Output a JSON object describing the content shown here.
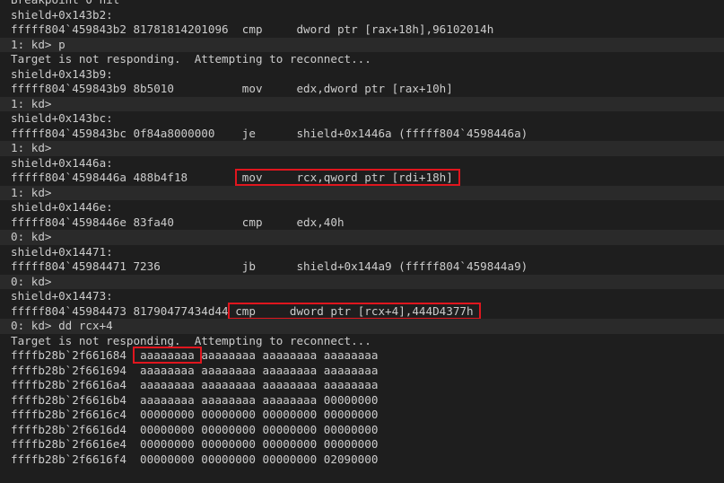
{
  "window": {
    "lines": [
      {
        "text": "Breakpoint 0 hit",
        "kind": "output"
      },
      {
        "text": "shield+0x143b2:",
        "kind": "output"
      },
      {
        "prefix": "fffff804`459843b2 81781814201096  ",
        "instr": "cmp     dword ptr [rax+18h],96102014h",
        "kind": "output"
      },
      {
        "text": "1: kd> p",
        "kind": "command"
      },
      {
        "text": "Target is not responding.  Attempting to reconnect...",
        "kind": "output"
      },
      {
        "text": "shield+0x143b9:",
        "kind": "output"
      },
      {
        "prefix": "fffff804`459843b9 8b5010          ",
        "instr": "mov     edx,dword ptr [rax+10h]",
        "kind": "output"
      },
      {
        "text": "1: kd>",
        "kind": "command"
      },
      {
        "text": "shield+0x143bc:",
        "kind": "output"
      },
      {
        "prefix": "fffff804`459843bc 0f84a8000000    ",
        "instr": "je      shield+0x1446a (fffff804`4598446a)",
        "kind": "output"
      },
      {
        "text": "1: kd>",
        "kind": "command"
      },
      {
        "text": "shield+0x1446a:",
        "kind": "output"
      },
      {
        "prefix": "fffff804`4598446a 488b4f18        ",
        "instr": "mov     rcx,qword ptr [rdi+18h]",
        "kind": "output",
        "highlight": true
      },
      {
        "text": "1: kd>",
        "kind": "command"
      },
      {
        "text": "shield+0x1446e:",
        "kind": "output"
      },
      {
        "prefix": "fffff804`4598446e 83fa40          ",
        "instr": "cmp     edx,40h",
        "kind": "output"
      },
      {
        "text": "0: kd>",
        "kind": "command"
      },
      {
        "text": "shield+0x14471:",
        "kind": "output"
      },
      {
        "prefix": "fffff804`45984471 7236            ",
        "instr": "jb      shield+0x144a9 (fffff804`459844a9)",
        "kind": "output"
      },
      {
        "text": "0: kd>",
        "kind": "command"
      },
      {
        "text": "shield+0x14473:",
        "kind": "output"
      },
      {
        "prefix": "fffff804`45984473 81790477434d44 ",
        "instr": "cmp     dword ptr [rcx+4],444D4377h",
        "kind": "output",
        "highlight": true
      },
      {
        "text": "0: kd> dd rcx+4",
        "kind": "command"
      },
      {
        "text": "Target is not responding.  Attempting to reconnect...",
        "kind": "output"
      },
      {
        "prefix": "ffffb28b`2f661684  ",
        "instr": "aaaaaaaa",
        "suffix": " aaaaaaaa aaaaaaaa aaaaaaaa",
        "kind": "output",
        "highlight": true
      },
      {
        "text": "ffffb28b`2f661694  aaaaaaaa aaaaaaaa aaaaaaaa aaaaaaaa",
        "kind": "output"
      },
      {
        "text": "ffffb28b`2f6616a4  aaaaaaaa aaaaaaaa aaaaaaaa aaaaaaaa",
        "kind": "output"
      },
      {
        "text": "ffffb28b`2f6616b4  aaaaaaaa aaaaaaaa aaaaaaaa 00000000",
        "kind": "output"
      },
      {
        "text": "ffffb28b`2f6616c4  00000000 00000000 00000000 00000000",
        "kind": "output"
      },
      {
        "text": "ffffb28b`2f6616d4  00000000 00000000 00000000 00000000",
        "kind": "output"
      },
      {
        "text": "ffffb28b`2f6616e4  00000000 00000000 00000000 00000000",
        "kind": "output"
      },
      {
        "text": "ffffb28b`2f6616f4  00000000 00000000 00000000 02090000",
        "kind": "output"
      }
    ]
  }
}
